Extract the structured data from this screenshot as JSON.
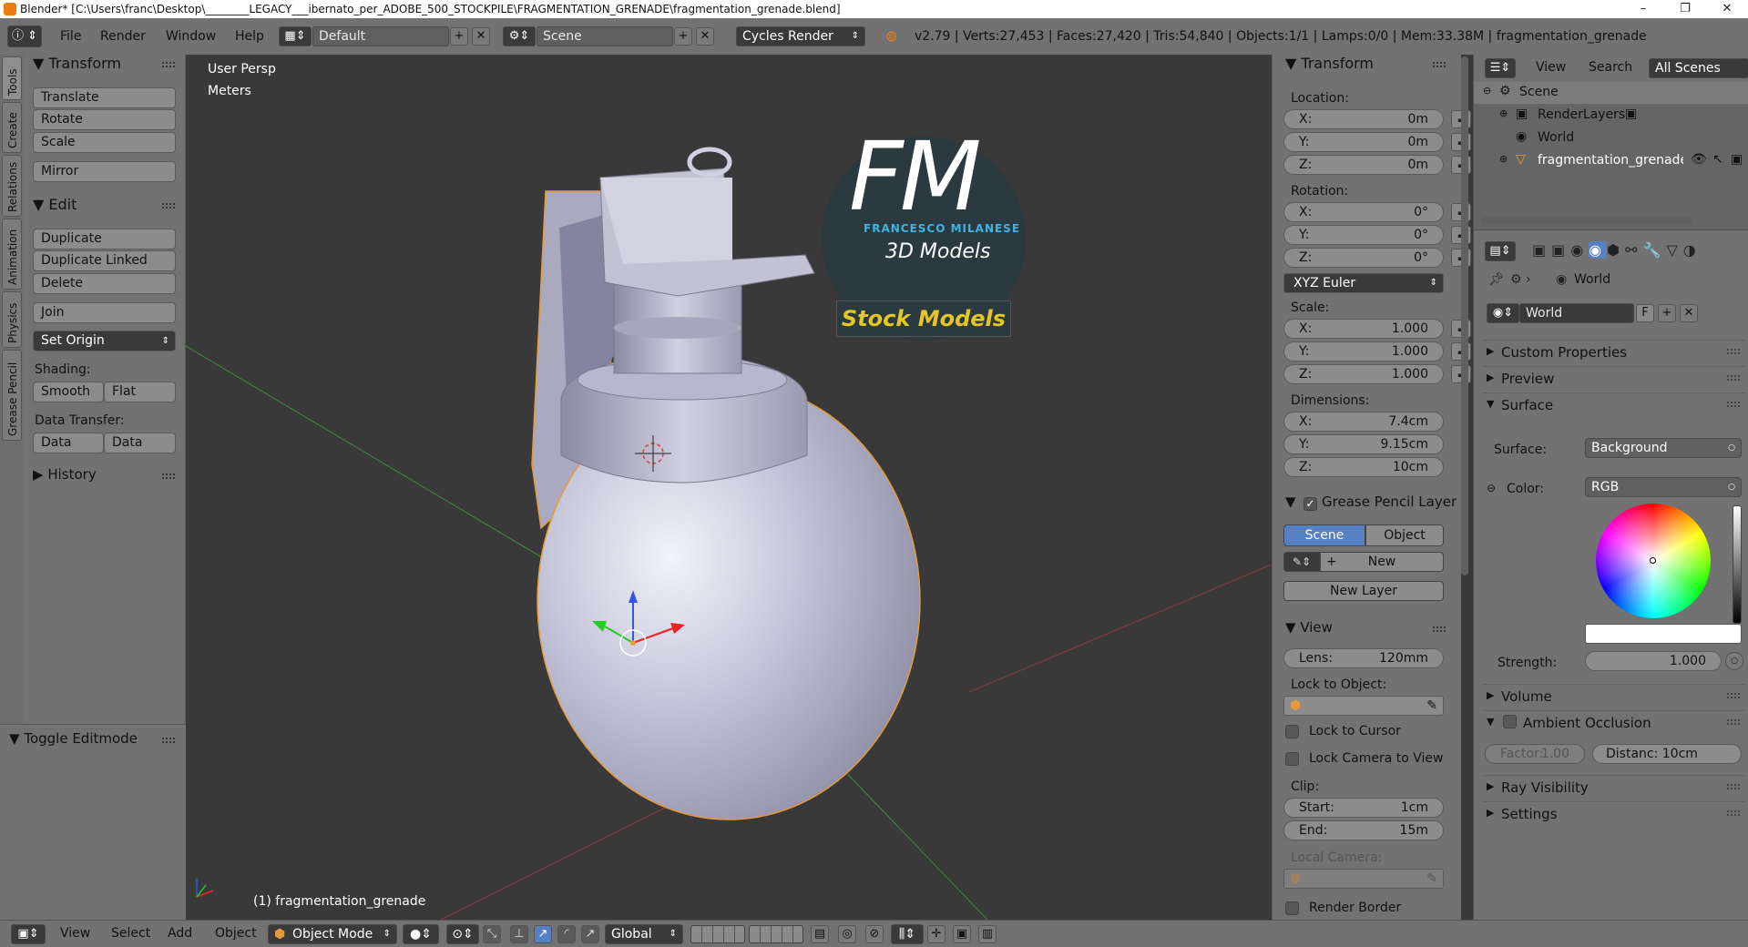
{
  "window": {
    "title": "Blender* [C:\\Users\\franc\\Desktop\\________LEGACY___ibernato_per_ADOBE_500_STOCKPILE\\FRAGMENTATION_GRENADE\\fragmentation_grenade.blend]",
    "minimize": "–",
    "maximize": "❐",
    "close": "✕"
  },
  "header": {
    "menus": [
      "File",
      "Render",
      "Window",
      "Help"
    ],
    "layout": "Default",
    "scene": "Scene",
    "engine": "Cycles Render",
    "stats": "v2.79 | Verts:27,453 | Faces:27,420 | Tris:54,840 | Objects:1/1 | Lamps:0/0 | Mem:33.38M | fragmentation_grenade"
  },
  "tool_tabs": [
    "Tools",
    "Create",
    "Relations",
    "Animation",
    "Physics",
    "Grease Pencil"
  ],
  "toolshelf": {
    "transform_title": "Transform",
    "translate": "Translate",
    "rotate": "Rotate",
    "scale": "Scale",
    "mirror": "Mirror",
    "edit_title": "Edit",
    "duplicate": "Duplicate",
    "duplicate_linked": "Duplicate Linked",
    "delete": "Delete",
    "join": "Join",
    "set_origin": "Set Origin",
    "shading_label": "Shading:",
    "smooth": "Smooth",
    "flat": "Flat",
    "data_transfer_label": "Data Transfer:",
    "data": "Data",
    "data_layout": "Data Layo",
    "history": "History",
    "toggle_editmode": "Toggle Editmode"
  },
  "viewport": {
    "view_name": "User Persp",
    "units": "Meters",
    "object_label": "(1) fragmentation_grenade",
    "logo_fm": "FM",
    "logo_author": "FRANCESCO MILANESE",
    "logo_sub": "3D Models",
    "logo_banner": "Stock Models"
  },
  "npanel": {
    "transform_title": "Transform",
    "location_label": "Location:",
    "location": [
      {
        "k": "X:",
        "v": "0m"
      },
      {
        "k": "Y:",
        "v": "0m"
      },
      {
        "k": "Z:",
        "v": "0m"
      }
    ],
    "rotation_label": "Rotation:",
    "rotation": [
      {
        "k": "X:",
        "v": "0°"
      },
      {
        "k": "Y:",
        "v": "0°"
      },
      {
        "k": "Z:",
        "v": "0°"
      }
    ],
    "rotation_mode": "XYZ Euler",
    "scale_label": "Scale:",
    "scale": [
      {
        "k": "X:",
        "v": "1.000"
      },
      {
        "k": "Y:",
        "v": "1.000"
      },
      {
        "k": "Z:",
        "v": "1.000"
      }
    ],
    "dimensions_label": "Dimensions:",
    "dimensions": [
      {
        "k": "X:",
        "v": "7.4cm"
      },
      {
        "k": "Y:",
        "v": "9.15cm"
      },
      {
        "k": "Z:",
        "v": "10cm"
      }
    ],
    "grease_pencil_title": "Grease Pencil Layer",
    "gp_scene": "Scene",
    "gp_object": "Object",
    "gp_new": "New",
    "gp_new_layer": "New Layer",
    "view_title": "View",
    "lens_key": "Lens:",
    "lens_val": "120mm",
    "lock_to_object": "Lock to Object:",
    "lock_to_cursor": "Lock to Cursor",
    "lock_camera": "Lock Camera to View",
    "clip_label": "Clip:",
    "clip_start_key": "Start:",
    "clip_start_val": "1cm",
    "clip_end_key": "End:",
    "clip_end_val": "15m",
    "local_camera": "Local Camera:",
    "render_border": "Render Border"
  },
  "outliner": {
    "menus": [
      "View",
      "Search"
    ],
    "filter": "All Scenes",
    "items": [
      "Scene",
      "RenderLayers",
      "World",
      "fragmentation_grenade"
    ]
  },
  "properties": {
    "context_label": "World",
    "world_name": "World",
    "fake_user": "F",
    "custom_properties": "Custom Properties",
    "preview": "Preview",
    "surface": "Surface",
    "surface_label": "Surface:",
    "surface_value": "Background",
    "color_label": "Color:",
    "color_value": "RGB",
    "strength_label": "Strength:",
    "strength_value": "1.000",
    "volume": "Volume",
    "ambient_occlusion": "Ambient Occlusion",
    "factor": "Factor:",
    "factor_value": "1.00",
    "distance": "Distanc: 10cm",
    "ray_visibility": "Ray Visibility",
    "settings": "Settings"
  },
  "bottombar": {
    "menus": [
      "View",
      "Select",
      "Add",
      "Object"
    ],
    "mode": "Object Mode",
    "orientation": "Global"
  },
  "colors": {
    "panel": "#727272",
    "viewport": "#393939",
    "selection": "#5680c2",
    "mesh": "#b6b6cc",
    "outline": "#e59a3c"
  }
}
